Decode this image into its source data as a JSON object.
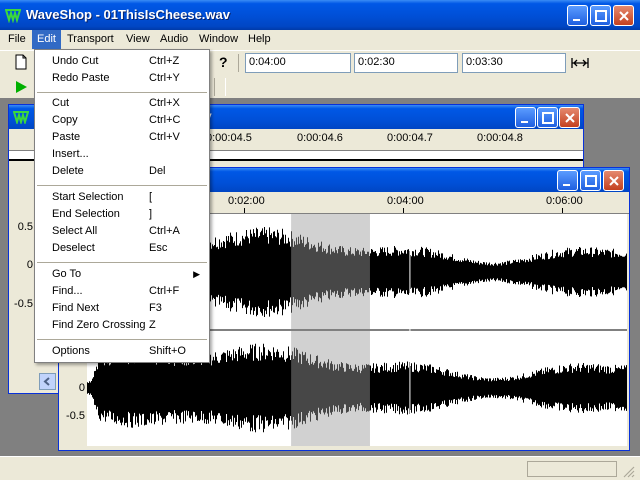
{
  "window": {
    "title": "WaveShop - 01ThisIsCheese.wav"
  },
  "menubar": {
    "items": [
      {
        "label": "File"
      },
      {
        "label": "Edit"
      },
      {
        "label": "Transport"
      },
      {
        "label": "View"
      },
      {
        "label": "Audio"
      },
      {
        "label": "Window"
      },
      {
        "label": "Help"
      }
    ]
  },
  "toolbar": {
    "time_start": "0:04:00",
    "time_length": "0:02:30",
    "time_end": "0:03:30"
  },
  "edit_menu": {
    "items": [
      {
        "label": "Undo Cut",
        "shortcut": "Ctrl+Z"
      },
      {
        "label": "Redo Paste",
        "shortcut": "Ctrl+Y"
      },
      {
        "label": "Cut",
        "shortcut": "Ctrl+X"
      },
      {
        "label": "Copy",
        "shortcut": "Ctrl+C"
      },
      {
        "label": "Paste",
        "shortcut": "Ctrl+V"
      },
      {
        "label": "Insert...",
        "shortcut": ""
      },
      {
        "label": "Delete",
        "shortcut": "Del"
      },
      {
        "label": "Start Selection",
        "shortcut": "["
      },
      {
        "label": "End Selection",
        "shortcut": "]"
      },
      {
        "label": "Select All",
        "shortcut": "Ctrl+A"
      },
      {
        "label": "Deselect",
        "shortcut": "Esc"
      },
      {
        "label": "Go To",
        "shortcut": ""
      },
      {
        "label": "Find...",
        "shortcut": "Ctrl+F"
      },
      {
        "label": "Find Next",
        "shortcut": "F3"
      },
      {
        "label": "Find Zero Crossing",
        "shortcut": "Z"
      },
      {
        "label": "Options",
        "shortcut": "Shift+O"
      }
    ]
  },
  "back_window": {
    "ruler_labels": [
      "0:00:04.5",
      "0:00:04.6",
      "0:00:04.7",
      "0:00:04.8"
    ],
    "y_labels": [
      "0.5",
      "0",
      "-0.5"
    ],
    "partial_title_char": "y"
  },
  "front_window": {
    "ruler_labels": [
      "0:02:00",
      "0:04:00",
      "0:06:00"
    ],
    "y_labels": [
      "0",
      "-0.5"
    ],
    "selection_fraction": [
      0.378,
      0.524
    ],
    "cursor_fraction": 0.598
  },
  "colors": {
    "titlebar": "#0054e3",
    "selection": "#c0c0c0",
    "menu_highlight": "#316ac5"
  }
}
